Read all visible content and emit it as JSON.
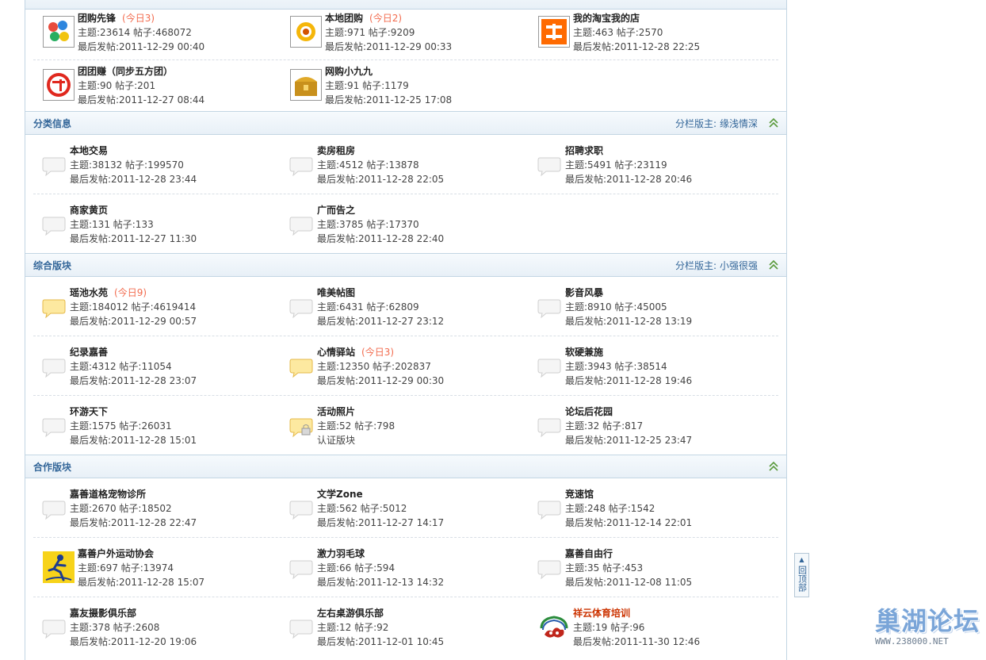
{
  "categories": [
    {
      "title": "",
      "moderators_label": "",
      "moderators": "",
      "forums": [
        {
          "name": "团购先锋",
          "today": "(今日3)",
          "stats": "主题:23614   帖子:468072",
          "last": "最后发帖:2011-12-29 00:40",
          "icon": "group-buy-logo-icon"
        },
        {
          "name": "本地团购",
          "today": "(今日2)",
          "stats": "主题:971   帖子:9209",
          "last": "最后发帖:2011-12-29 00:33",
          "icon": "local-group-buy-logo-icon"
        },
        {
          "name": "我的淘宝我的店",
          "today": "",
          "stats": "主题:463   帖子:2570",
          "last": "最后发帖:2011-12-28 22:25",
          "icon": "taobao-logo-icon"
        },
        {
          "name": "团团赚（同步五方团）",
          "today": "",
          "stats": "主题:90   帖子:201",
          "last": "最后发帖:2011-12-27 08:44",
          "icon": "tuan-logo-icon"
        },
        {
          "name": "网购小九九",
          "today": "",
          "stats": "主题:91   帖子:1179",
          "last": "最后发帖:2011-12-25 17:08",
          "icon": "treasure-chest-icon"
        }
      ]
    },
    {
      "title": "分类信息",
      "moderators_label": "分栏版主:",
      "moderators": "缘浅情深",
      "forums": [
        {
          "name": "本地交易",
          "today": "",
          "stats": "主题:38132   帖子:199570",
          "last": "最后发帖:2011-12-28 23:44",
          "icon": "bubble-gray-icon"
        },
        {
          "name": "卖房租房",
          "today": "",
          "stats": "主题:4512   帖子:13878",
          "last": "最后发帖:2011-12-28 22:05",
          "icon": "bubble-gray-icon"
        },
        {
          "name": "招聘求职",
          "today": "",
          "stats": "主题:5491   帖子:23119",
          "last": "最后发帖:2011-12-28 20:46",
          "icon": "bubble-gray-icon"
        },
        {
          "name": "商家黄页",
          "today": "",
          "stats": "主题:131   帖子:133",
          "last": "最后发帖:2011-12-27 11:30",
          "icon": "bubble-gray-icon"
        },
        {
          "name": "广而告之",
          "today": "",
          "stats": "主题:3785   帖子:17370",
          "last": "最后发帖:2011-12-28 22:40",
          "icon": "bubble-gray-icon"
        }
      ]
    },
    {
      "title": "综合版块",
      "moderators_label": "分栏版主:",
      "moderators": "小强很强",
      "forums": [
        {
          "name": "瑶池水苑",
          "today": "(今日9)",
          "stats": "主题:184012   帖子:4619414",
          "last": "最后发帖:2011-12-29 00:57",
          "icon": "bubble-yellow-icon"
        },
        {
          "name": "唯美帖图",
          "today": "",
          "stats": "主题:6431   帖子:62809",
          "last": "最后发帖:2011-12-27 23:12",
          "icon": "bubble-gray-icon"
        },
        {
          "name": "影音风暴",
          "today": "",
          "stats": "主题:8910   帖子:45005",
          "last": "最后发帖:2011-12-28 13:19",
          "icon": "bubble-gray-icon"
        },
        {
          "name": "纪录嘉善",
          "today": "",
          "stats": "主题:4312   帖子:11054",
          "last": "最后发帖:2011-12-28 23:07",
          "icon": "bubble-gray-icon"
        },
        {
          "name": "心情驿站",
          "today": "(今日3)",
          "stats": "主题:12350   帖子:202837",
          "last": "最后发帖:2011-12-29 00:30",
          "icon": "bubble-yellow-icon"
        },
        {
          "name": "软硬兼施",
          "today": "",
          "stats": "主题:3943   帖子:38514",
          "last": "最后发帖:2011-12-28 19:46",
          "icon": "bubble-gray-icon"
        },
        {
          "name": "环游天下",
          "today": "",
          "stats": "主题:1575   帖子:26031",
          "last": "最后发帖:2011-12-28 15:01",
          "icon": "bubble-gray-icon"
        },
        {
          "name": "活动照片",
          "today": "",
          "stats": "主题:52   帖子:798",
          "last": "认证版块",
          "icon": "bubble-locked-icon"
        },
        {
          "name": "论坛后花园",
          "today": "",
          "stats": "主题:32   帖子:817",
          "last": "最后发帖:2011-12-25 23:47",
          "icon": "bubble-gray-icon"
        }
      ]
    },
    {
      "title": "合作版块",
      "moderators_label": "",
      "moderators": "",
      "forums": [
        {
          "name": "嘉善道格宠物诊所",
          "today": "",
          "stats": "主题:2670   帖子:18502",
          "last": "最后发帖:2011-12-28 22:47",
          "icon": "bubble-gray-icon"
        },
        {
          "name": "文学Zone",
          "today": "",
          "stats": "主题:562   帖子:5012",
          "last": "最后发帖:2011-12-27 14:17",
          "icon": "bubble-gray-icon"
        },
        {
          "name": "竞速馆",
          "today": "",
          "stats": "主题:248   帖子:1542",
          "last": "最后发帖:2011-12-14 22:01",
          "icon": "bubble-gray-icon"
        },
        {
          "name": "嘉善户外运动协会",
          "today": "",
          "stats": "主题:697   帖子:13974",
          "last": "最后发帖:2011-12-28 15:07",
          "icon": "outdoor-runner-logo-icon"
        },
        {
          "name": "激力羽毛球",
          "today": "",
          "stats": "主题:66   帖子:594",
          "last": "最后发帖:2011-12-13 14:32",
          "icon": "bubble-gray-icon"
        },
        {
          "name": "嘉善自由行",
          "today": "",
          "stats": "主题:35   帖子:453",
          "last": "最后发帖:2011-12-08 11:05",
          "icon": "bubble-gray-icon"
        },
        {
          "name": "嘉友摄影俱乐部",
          "today": "",
          "stats": "主题:378   帖子:2608",
          "last": "最后发帖:2011-12-20 19:06",
          "icon": "bubble-gray-icon"
        },
        {
          "name": "左右桌游俱乐部",
          "today": "",
          "stats": "主题:12   帖子:92",
          "last": "最后发帖:2011-12-01 10:45",
          "icon": "bubble-gray-icon"
        },
        {
          "name": "祥云体育培训",
          "today": "",
          "stats": "主题:19   帖子:96",
          "last": "最后发帖:2011-11-30 12:46",
          "icon": "xiangyun-cloud-logo-icon",
          "name_color": "#cc3300"
        }
      ]
    }
  ],
  "back_to_top": "回顶部",
  "watermark": {
    "title": "巢湖论坛",
    "url": "WWW.238000.NET"
  },
  "colors": {
    "accent": "#336699",
    "today": "#f26c4f",
    "border": "#c2d5e3",
    "collapse": "#5a9a3c"
  }
}
